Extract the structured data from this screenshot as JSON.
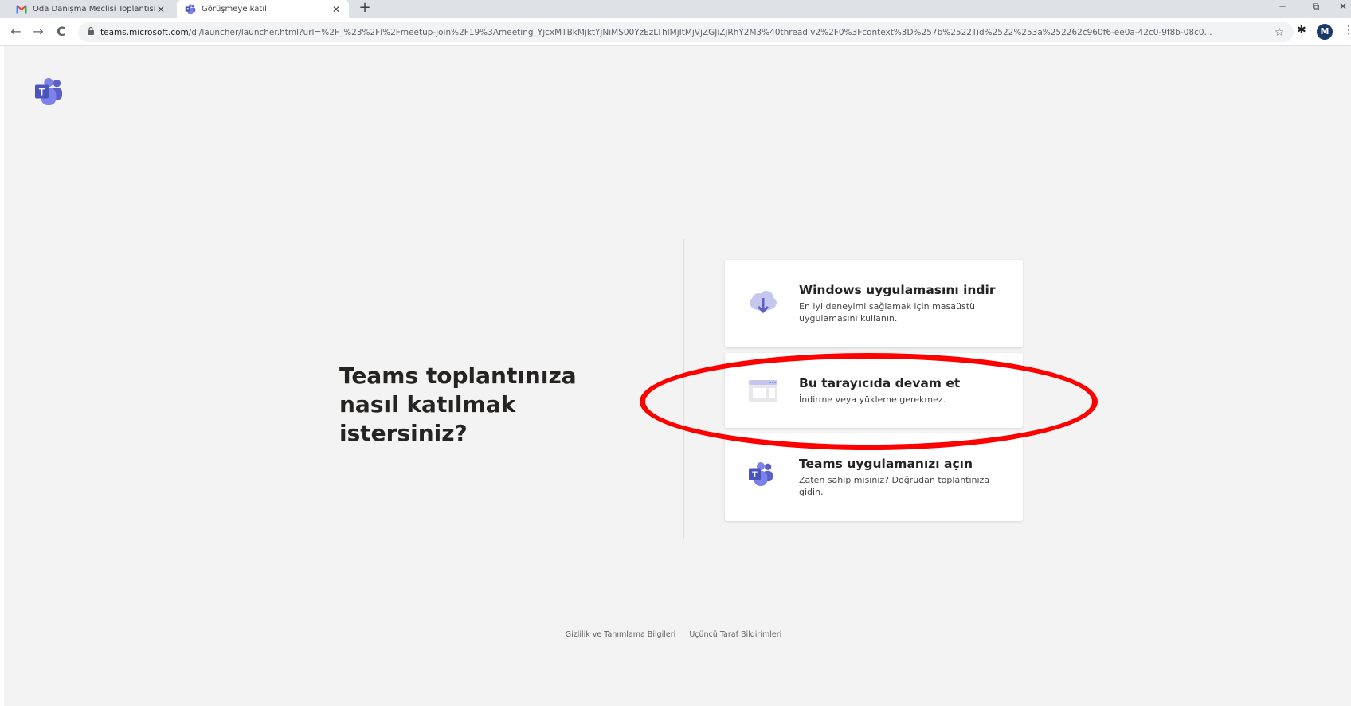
{
  "browser": {
    "tabs": [
      {
        "title": "Oda Danışma Meclisi Toplantısı (",
        "favicon": "gmail-icon",
        "active": false
      },
      {
        "title": "Görüşmeye katıl",
        "favicon": "teams-icon",
        "active": true
      }
    ],
    "close_glyph": "✕",
    "new_tab_glyph": "+",
    "window_controls": {
      "minimize": "─",
      "restore": "⧉",
      "close": "✕"
    },
    "nav": {
      "back": "←",
      "forward": "→",
      "reload": "C"
    },
    "url_domain": "teams.microsoft.com",
    "url_path": "/dl/launcher/launcher.html?url=%2F_%23%2Fl%2Fmeetup-join%2F19%3Ameeting_YjcxMTBkMjktYjNiMS00YzEzLThlMjItMjVjZGJiZjRhY2M3%40thread.v2%2F0%3Fcontext%3D%257b%2522Tid%2522%253a%252262c960f6-ee0a-42c0-9f8b-08c0...",
    "star_glyph": "☆",
    "extensions_glyph": "✱",
    "avatar_letter": "M",
    "menu_glyph": "⋮"
  },
  "page": {
    "question": "Teams toplantınıza nasıl katılmak istersiniz?",
    "options": [
      {
        "title": "Windows uygulamasını indir",
        "description": "En iyi deneyimi sağlamak için masaüstü uygulamasını kullanın.",
        "icon": "cloud-download-icon"
      },
      {
        "title": "Bu tarayıcıda devam et",
        "description": "İndirme veya yükleme gerekmez.",
        "icon": "browser-window-icon"
      },
      {
        "title": "Teams uygulamanızı açın",
        "description": "Zaten sahip misiniz? Doğrudan toplantınıza gidin.",
        "icon": "teams-icon"
      }
    ],
    "footer_links": [
      "Gizlilik ve Tanımlama Bilgileri",
      "Üçüncü Taraf Bildirimleri"
    ]
  },
  "colors": {
    "teams_purple": "#5b5fc7",
    "highlight_red": "#ff0000",
    "background": "#f3f3f3"
  }
}
